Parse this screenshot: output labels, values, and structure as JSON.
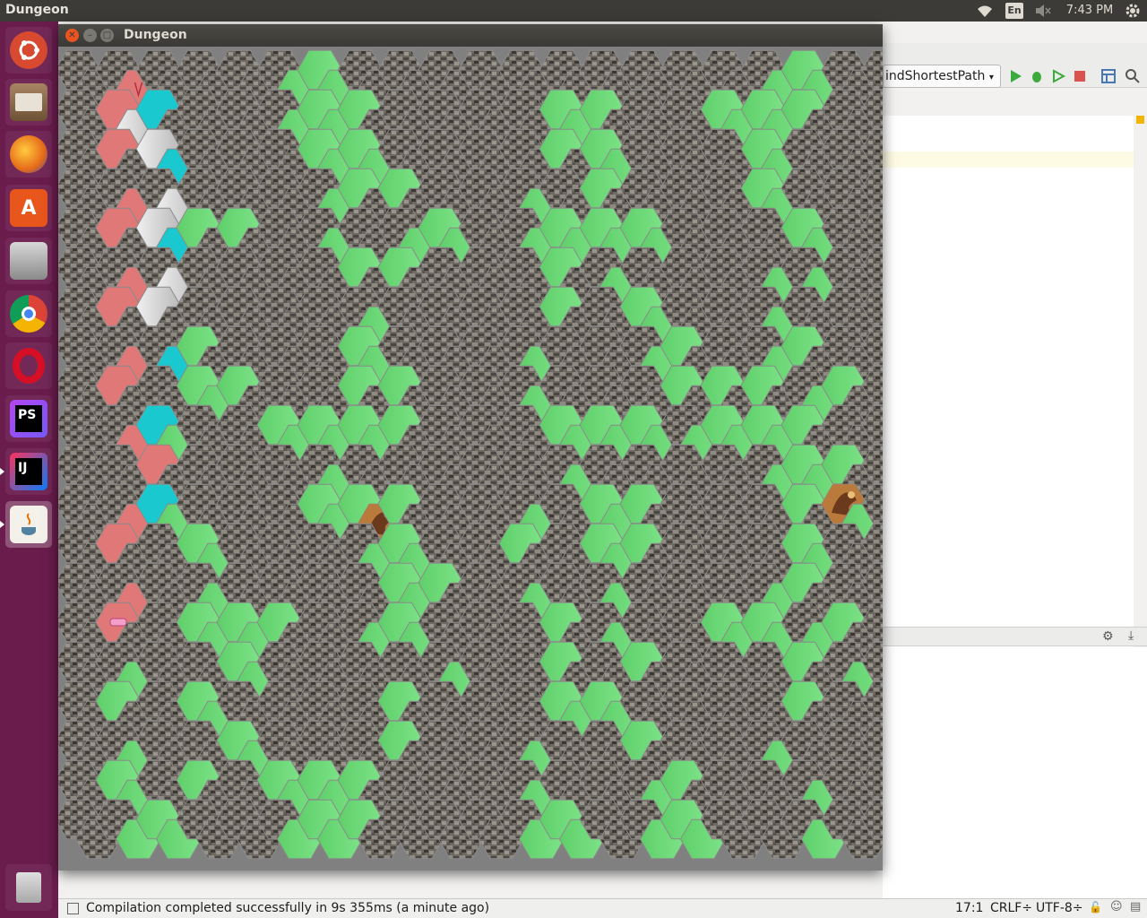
{
  "top_panel": {
    "title": "Dungeon",
    "keyboard_layout": "En",
    "clock": "7:43 PM"
  },
  "launcher": {
    "items": [
      {
        "name": "ubuntu-dash-icon",
        "color": "#d84a2f"
      },
      {
        "name": "files-icon",
        "color": "#8a6a4a"
      },
      {
        "name": "firefox-icon",
        "color": "#e66a1a"
      },
      {
        "name": "software-center-icon",
        "color": "#e8561c"
      },
      {
        "name": "disk-icon",
        "color": "#9a9a9a"
      },
      {
        "name": "chrome-icon",
        "color": "#4285f4"
      },
      {
        "name": "opera-icon",
        "color": "#d40f26"
      },
      {
        "name": "phpstorm-icon",
        "label": "PS",
        "color": "#6b3fb8"
      },
      {
        "name": "intellij-icon",
        "label": "IJ",
        "color": "#3a3a8a"
      },
      {
        "name": "java-icon",
        "color": "#e8e4dc"
      },
      {
        "name": "trash-icon",
        "color": "#bdbdbd"
      }
    ]
  },
  "ide": {
    "run_configuration": "indShortestPath",
    "status_message": "Compilation completed successfully in 9s 355ms (a minute ago)",
    "cursor_position": "17:1",
    "line_separator": "CRLF÷",
    "encoding": "UTF-8÷"
  },
  "dungeon_window": {
    "title": "Dungeon",
    "legend_colors": {
      "rock": "#6f6a63",
      "open": "#6fdc7a",
      "visited": "#e07878",
      "path": "#d6d6d6",
      "frontier": "#19c9cf"
    },
    "grid": {
      "columns": 41,
      "rows": 20,
      "cells": [
        "RRRCRRRRRRRGGGRRRRRRRRRRRRRRRRRRRRRGGGRRR",
        "RRCPFRRRRRRGGGGRRRRRRRRRGGGRRRRRGGGGGRRRR",
        "RRCRPFRRRRRRGGGGRRRRRRRRGRGGRRRRRRGGRRRRR",
        "RRRCRPRRRRRRRGGRGRRRRRRGRRGRRRRRRRGGRRRRR",
        "RRCRPFGRGRRRRGRRRGGGRRRGGGGGGGRRRRRRGGRRR",
        "RRRCRPRRRRRRRRGRGRRRRRRRGRRGRRRRRRRGRGRRR",
        "RRCRPRRRRRRRRRRGRRRRRRRRGRRRGGRRRRRGRRRRR",
        "RRRCRFGRRRRRRRGGRRRRRRRGRRRRRGGRRRRGGRRRR",
        "RRCRRRGGGRRRRRGRGRRRRRRGRRRRRRGRGRGRRGGRR",
        "RRRCFGRRRRGGGGGGGRRRRRRRGGGGGGRGGGGGGRRRR",
        "RRRRCRRRRRRRRGRRRRRRRRRRRGRRRRRRRRRGGGGRR",
        "RRRCFGRRRRRRGGGDGRRRRRRGRRGGGRRRRRRRGRDGR",
        "RRCRRRGGRRRRRRRGGGRRRRGRRRGGGRRRRRRRGGRRR",
        "RRRCRRRGRRRRRRRRGGGRRRRGRRRGRRRRRRRGGRRRR",
        "RRCRRRGGGGGRRRRGGGRRRRRRGRRGRRRRGGGGRGGRR",
        "RRRGRRRRGGRRRRRRRRRGRRRRGRRRGRRRRRRRGRRGR",
        "RRGRRRGGRRRRRRRRGRRRRRRRGGGGRRRRRRRRGRRRR",
        "RRRGRRRRGGRRRRRRGRRRRRRGRRRRGRRRRRRGRRRRR",
        "RRGGRRGRRRGGGGGRRRRRRRRGRRRRRGGRRRRRRGRRR",
        "RRRGGGRRRRRGGGGRRRRRRRRGGGRRRGGGRRRRRGRRR"
      ],
      "start_marker": "start-arrow-icon",
      "goal_marker": "goal-key-icon",
      "monster_marker": "dragon-icon"
    }
  }
}
